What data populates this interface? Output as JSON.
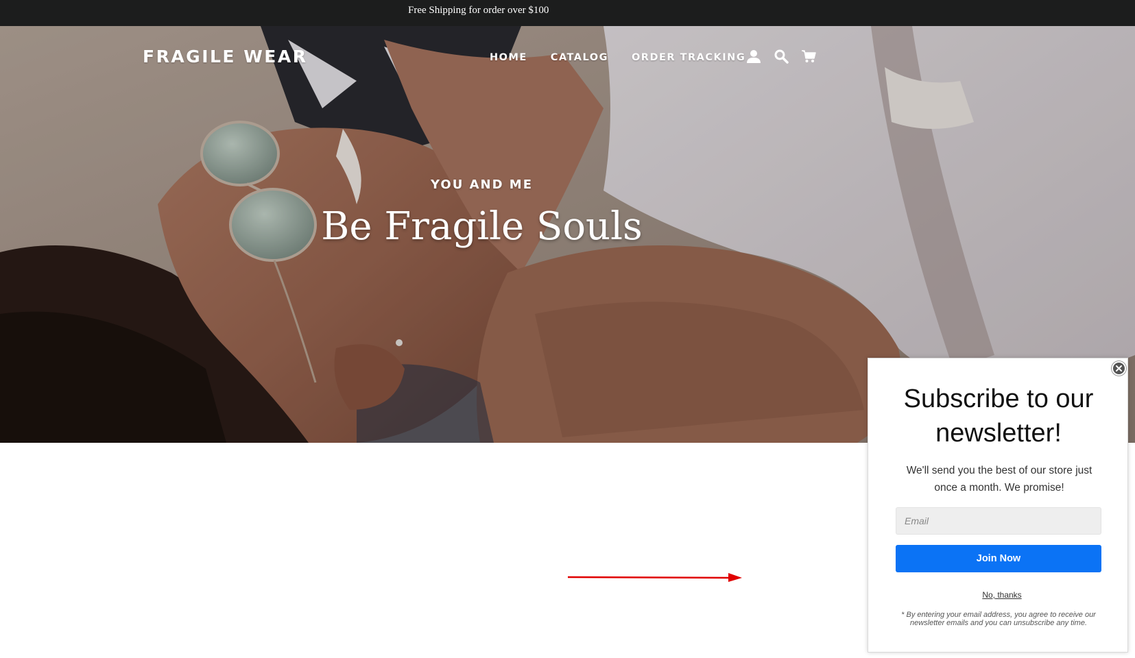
{
  "announcement": {
    "text": "Free Shipping for order over $100"
  },
  "header": {
    "logo": "FRAGILE WEAR",
    "nav": [
      {
        "label": "HOME"
      },
      {
        "label": "CATALOG"
      },
      {
        "label": "ORDER TRACKING"
      }
    ],
    "icons": [
      "account-icon",
      "search-icon",
      "cart-icon"
    ]
  },
  "hero": {
    "subheading": "YOU AND ME",
    "title": "Be Fragile Souls"
  },
  "popup": {
    "title": "Subscribe to our newsletter!",
    "description": "We'll send you the best of our store just once a month. We promise!",
    "email_placeholder": "Email",
    "join_label": "Join Now",
    "decline_label": "No, thanks",
    "disclaimer": "* By entering your email address, you agree to receive our newsletter emails and you can unsubscribe any time.",
    "button_color": "#0b73f5"
  },
  "annotation": {
    "arrow_color": "#e00000"
  }
}
